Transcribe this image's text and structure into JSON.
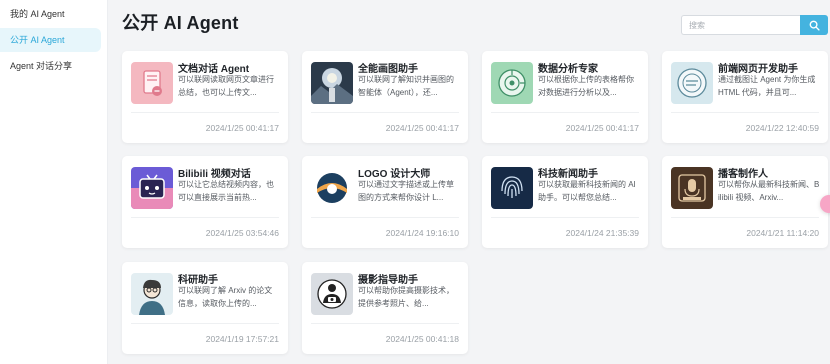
{
  "sidebar": {
    "items": [
      {
        "label": "我的 AI Agent"
      },
      {
        "label": "公开 AI Agent"
      },
      {
        "label": "Agent 对话分享"
      }
    ]
  },
  "header": {
    "title": "公开 AI Agent",
    "search_placeholder": "搜索"
  },
  "cards": [
    {
      "name": "文档对话 Agent",
      "desc": "可以联网读取网页文章进行总结，也可以上传文...",
      "time": "2024/1/25 00:41:17",
      "icon": "document-chat-icon"
    },
    {
      "name": "全能画图助手",
      "desc": "可以联网了解知识并画图的智能体（Agent），还...",
      "time": "2024/1/25 00:41:17",
      "icon": "painting-icon"
    },
    {
      "name": "数据分析专家",
      "desc": "可以根据你上传的表格帮你对数据进行分析以及...",
      "time": "2024/1/25 00:41:17",
      "icon": "data-analysis-icon"
    },
    {
      "name": "前端网页开发助手",
      "desc": "通过截图让 Agent 为你生成 HTML 代码，并且可...",
      "time": "2024/1/22 12:40:59",
      "icon": "web-dev-icon"
    },
    {
      "name": "Bilibili 视频对话",
      "desc": "可以让它总结视频内容，也可以直接展示当前热...",
      "time": "2024/1/25 03:54:46",
      "icon": "tv-icon"
    },
    {
      "name": "LOGO 设计大师",
      "desc": "可以通过文字描述或上传草图的方式来帮你设计 L...",
      "time": "2024/1/24 19:16:10",
      "icon": "logo-design-icon"
    },
    {
      "name": "科技新闻助手",
      "desc": "可以获取最新科技新闻的 AI 助手。可以帮您总结...",
      "time": "2024/1/24 21:35:39",
      "icon": "fingerprint-icon"
    },
    {
      "name": "播客制作人",
      "desc": "可以帮你从最新科技新闻、Bilibili 视频、Arxiv...",
      "time": "2024/1/21 11:14:20",
      "icon": "podcast-icon"
    },
    {
      "name": "科研助手",
      "desc": "可以联网了解 Arxiv 的论文信息，读取你上传的...",
      "time": "2024/1/19 17:57:21",
      "icon": "scientist-icon"
    },
    {
      "name": "摄影指导助手",
      "desc": "可以帮助你提高摄影技术，提供参考照片、给...",
      "time": "2024/1/25 00:41:18",
      "icon": "camera-icon"
    }
  ],
  "colors": {
    "accent": "#2aa7d8",
    "search_button": "#44b3df"
  }
}
